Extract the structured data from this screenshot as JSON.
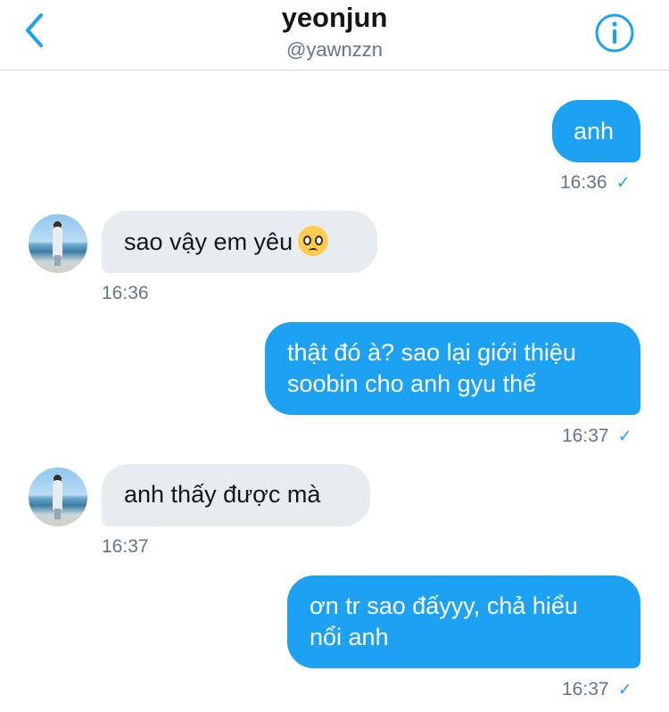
{
  "header": {
    "title": "yeonjun",
    "handle": "@yawnzzn"
  },
  "colors": {
    "accent": "#1da1f2",
    "incoming_bubble": "#e6ecf0",
    "meta_text": "#657786"
  },
  "icons": {
    "back": "chevron-left-icon",
    "info": "info-circle-icon",
    "read": "checkmark-icon"
  },
  "messages": [
    {
      "direction": "out",
      "lines": [
        "anh"
      ],
      "time": "16:36",
      "status": "✓"
    },
    {
      "direction": "in",
      "lines": [
        "sao vậy em yêu"
      ],
      "emoji": "pleading-face-emoji",
      "time": "16:36"
    },
    {
      "direction": "out",
      "lines": [
        "thật đó à? sao lại giới thiệu",
        "soobin cho anh gyu thế"
      ],
      "time": "16:37",
      "status": "✓"
    },
    {
      "direction": "in",
      "lines": [
        "anh thấy được mà"
      ],
      "time": "16:37"
    },
    {
      "direction": "out",
      "lines": [
        "ơn tr sao đấyyy, chả hiểu",
        "nổi anh"
      ],
      "time": "16:37",
      "status": "✓"
    }
  ]
}
